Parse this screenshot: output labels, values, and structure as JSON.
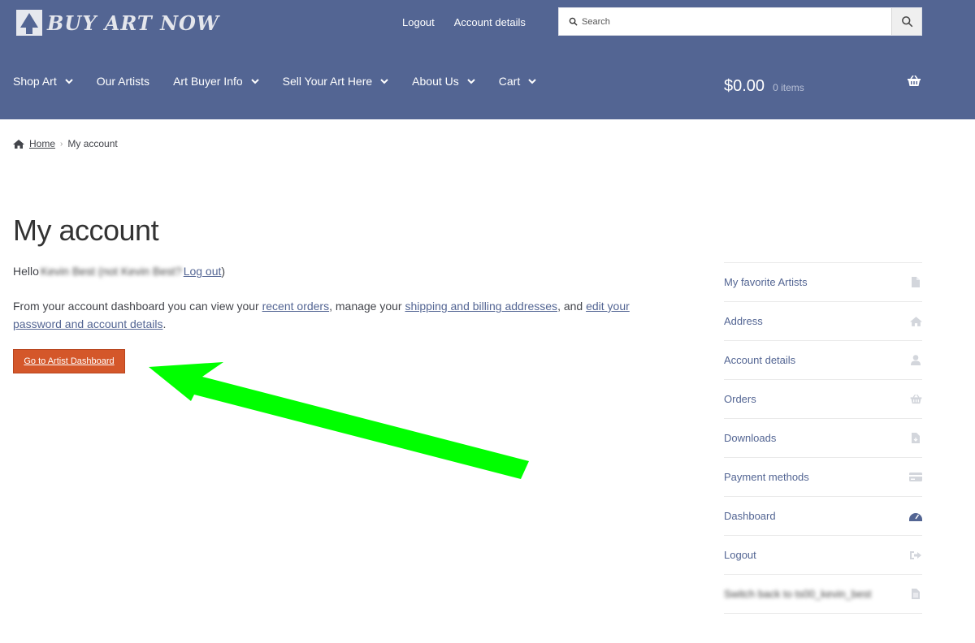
{
  "header": {
    "logo_text": "BUY ART NOW",
    "top_links": [
      "Logout",
      "Account details"
    ],
    "search_placeholder": "Search",
    "nav": [
      {
        "label": "Shop Art",
        "dropdown": true
      },
      {
        "label": "Our Artists",
        "dropdown": false
      },
      {
        "label": "Art Buyer Info",
        "dropdown": true
      },
      {
        "label": "Sell Your Art Here",
        "dropdown": true
      },
      {
        "label": "About Us",
        "dropdown": true
      },
      {
        "label": "Cart",
        "dropdown": true
      }
    ],
    "cart_amount": "$0.00",
    "cart_count": "0 items",
    "colors": {
      "header_bg": "#536593",
      "button": "#d4572a",
      "arrow": "#00ff00"
    }
  },
  "breadcrumb": {
    "home": "Home",
    "current": "My account"
  },
  "main": {
    "title": "My account",
    "hello_prefix": "Hello",
    "hello_name": "Kevin Best",
    "hello_not": "(not",
    "hello_name2": "Kevin Best?",
    "hello_logout": "Log out",
    "hello_close": ")",
    "dash_intro": "From your account dashboard you can view your",
    "dash_link1": "recent orders",
    "dash_mid1": ", manage your",
    "dash_link2": "shipping and billing addresses",
    "dash_mid2": ", and",
    "dash_link3": "edit your password and account details",
    "dash_end": ".",
    "artist_button": "Go to Artist Dashboard"
  },
  "sidebar": {
    "items": [
      {
        "label": "My favorite Artists",
        "icon": "file-icon"
      },
      {
        "label": "Address",
        "icon": "home-icon"
      },
      {
        "label": "Account details",
        "icon": "user-icon"
      },
      {
        "label": "Orders",
        "icon": "basket-icon"
      },
      {
        "label": "Downloads",
        "icon": "file-download-icon"
      },
      {
        "label": "Payment methods",
        "icon": "credit-card-icon"
      },
      {
        "label": "Dashboard",
        "icon": "tachometer-icon",
        "active": true
      },
      {
        "label": "Logout",
        "icon": "sign-out-icon"
      },
      {
        "label": "Switch back to ts00_kevin_best",
        "icon": "file-icon",
        "blurred": true
      }
    ]
  }
}
